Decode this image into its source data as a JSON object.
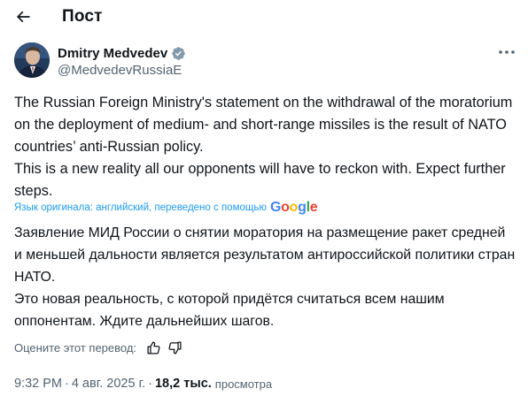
{
  "header": {
    "title": "Пост",
    "back_icon": "arrow-left-icon"
  },
  "author": {
    "name": "Dmitry Medvedev",
    "handle": "@MedvedevRussiaE",
    "verified_badge": "verified-badge-icon",
    "badge_color": "#829aab"
  },
  "tweet": {
    "paragraphs": [
      "The Russian Foreign Ministry's statement on the withdrawal of the moratorium on the deployment of medium- and short-range missiles is the result of NATO countries’ anti-Russian policy.",
      "This is a new reality all our opponents will have to reckon with. Expect further steps."
    ]
  },
  "translation": {
    "note": "Язык оригинала: английский, переведено с помощью",
    "provider": "Google",
    "paragraphs": [
      "Заявление МИД России о снятии моратория на размещение ракет средней и меньшей дальности является результатом антироссийской политики стран НАТО.",
      "Это новая реальность, с которой придётся считаться всем нашим оппонентам. Ждите дальнейших шагов."
    ],
    "rate_label": "Оцените этот перевод:",
    "thumbs_up_icon": "thumbs-up-icon",
    "thumbs_down_icon": "thumbs-down-icon"
  },
  "meta": {
    "time": "9:32 PM",
    "date": "4 авг. 2025 г.",
    "separator": "·",
    "views_count": "18,2 тыс.",
    "views_label": "просмотра"
  },
  "colors": {
    "text": "#0f1419",
    "secondary": "#536471",
    "link": "#1d9bf0"
  }
}
